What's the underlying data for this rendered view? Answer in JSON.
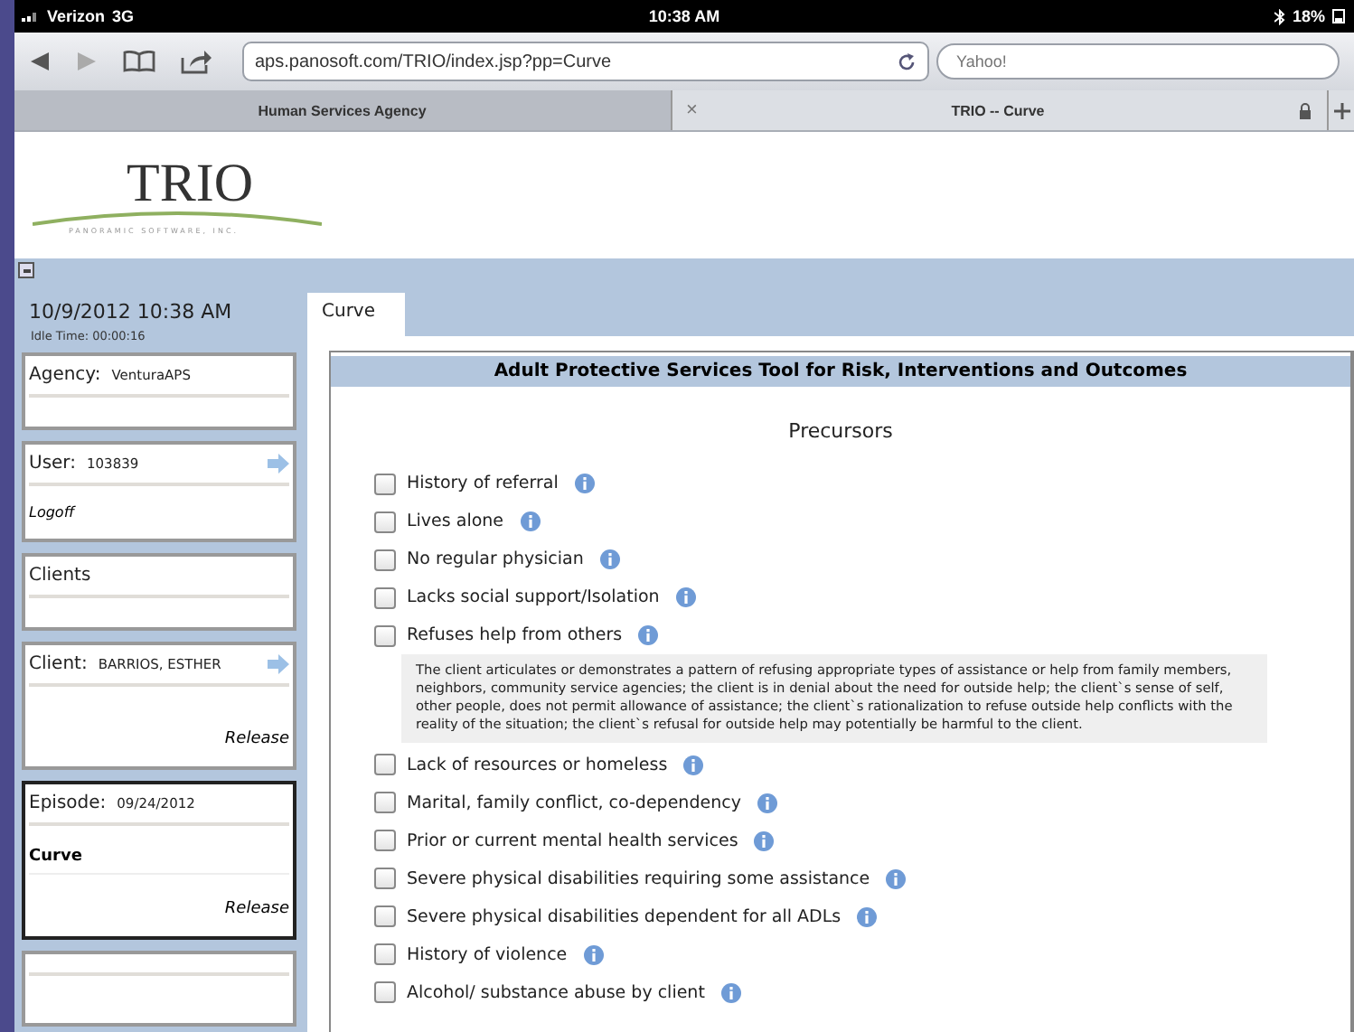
{
  "status_bar": {
    "carrier": "Verizon",
    "network": "3G",
    "time": "10:38 AM",
    "battery": "18%"
  },
  "browser": {
    "url": "aps.panosoft.com/TRIO/index.jsp?pp=Curve",
    "search_placeholder": "Yahoo!",
    "close_tab": "×",
    "tabs": [
      {
        "label": "Human Services Agency",
        "selected": false
      },
      {
        "label": "TRIO -- Curve",
        "selected": true
      }
    ]
  },
  "logo": {
    "name": "TRIO",
    "tagline": "PANORAMIC SOFTWARE, INC."
  },
  "sidebar": {
    "datetime": "10/9/2012 10:38 AM",
    "idle_time": "Idle Time: 00:00:16",
    "panels": [
      {
        "kind": "info",
        "label": "Agency:",
        "value": "VenturaAPS",
        "arrow": false,
        "selected": false
      },
      {
        "kind": "user",
        "label": "User:",
        "value": "103839",
        "arrow": true,
        "link": "Logoff",
        "selected": false
      },
      {
        "kind": "info",
        "label": "Clients",
        "arrow": false,
        "selected": false
      },
      {
        "kind": "record",
        "label": "Client:",
        "value": "BARRIOS, ESTHER",
        "arrow": true,
        "link": "Release",
        "selected": false
      },
      {
        "kind": "record",
        "label": "Episode:",
        "value": "09/24/2012",
        "arrow": false,
        "subtitle": "Curve",
        "link": "Release",
        "selected": true
      },
      {
        "kind": "info",
        "arrow": false,
        "selected": false
      }
    ]
  },
  "tabs": [
    {
      "label": "Curve",
      "selected": true
    }
  ],
  "form": {
    "title": "Adult Protective Services Tool for Risk, Interventions and Outcomes",
    "section": "Precursors",
    "items": [
      {
        "label": "History of referral",
        "checked": false
      },
      {
        "label": "Lives alone",
        "checked": false
      },
      {
        "label": "No regular physician",
        "checked": false
      },
      {
        "label": "Lacks social support/Isolation",
        "checked": false
      },
      {
        "label": "Refuses help from others",
        "checked": false,
        "description": "The client articulates or demonstrates a pattern of refusing appropriate types of assistance or help from family members, neighbors, community service agencies; the client is in denial about the need for outside help; the client`s sense of self, other people, does not permit allowance of assistance; the client`s rationalization to refuse outside help conflicts with the reality of the situation; the client`s refusal for outside help may potentially be harmful to the client."
      },
      {
        "label": "Lack of resources or homeless",
        "checked": false
      },
      {
        "label": "Marital, family conflict, co-dependency",
        "checked": false
      },
      {
        "label": "Prior or current mental health services",
        "checked": false
      },
      {
        "label": "Severe physical disabilities requiring some assistance",
        "checked": false
      },
      {
        "label": "Severe physical disabilities dependent for all ADLs",
        "checked": false
      },
      {
        "label": "History of violence",
        "checked": false
      },
      {
        "label": "Alcohol/ substance abuse by client",
        "checked": false
      }
    ]
  }
}
